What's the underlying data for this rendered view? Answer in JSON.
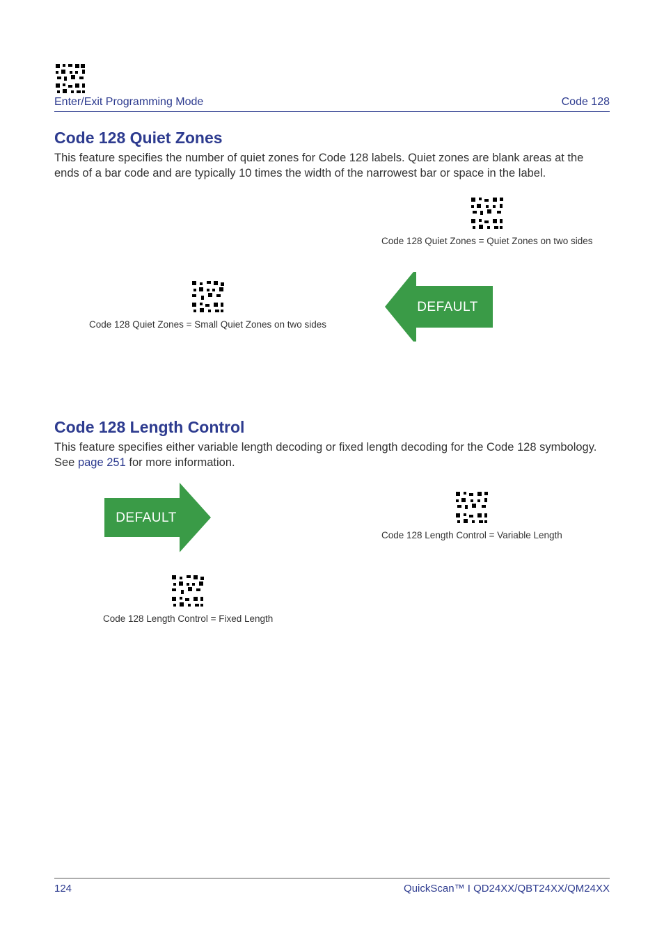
{
  "header": {
    "left_label": "Enter/Exit Programming Mode",
    "right_label": "Code 128"
  },
  "section1": {
    "title": "Code 128 Quiet Zones",
    "body": "This feature specifies the number of quiet zones for Code 128 labels. Quiet zones are blank areas at the ends of a bar code and are typically 10 times the width of the narrowest bar or space in the label.",
    "option_a_caption": "Code 128 Quiet Zones = Quiet Zones on two sides",
    "option_b_caption": "Code 128 Quiet Zones = Small Quiet Zones on two sides",
    "default_label": "DEFAULT"
  },
  "section2": {
    "title": "Code 128 Length Control",
    "body_pre": "This feature specifies either variable length decoding or fixed length decoding for the Code 128 symbology. See ",
    "body_link": "page 251",
    "body_post": " for more information.",
    "option_a_caption": "Code 128 Length Control = Variable Length",
    "option_b_caption": "Code 128 Length Control = Fixed Length",
    "default_label": "DEFAULT"
  },
  "footer": {
    "page_number": "124",
    "product": "QuickScan™ I QD24XX/QBT24XX/QM24XX"
  },
  "colors": {
    "brand": "#2d3b8f",
    "arrow_green": "#3a9b47"
  }
}
